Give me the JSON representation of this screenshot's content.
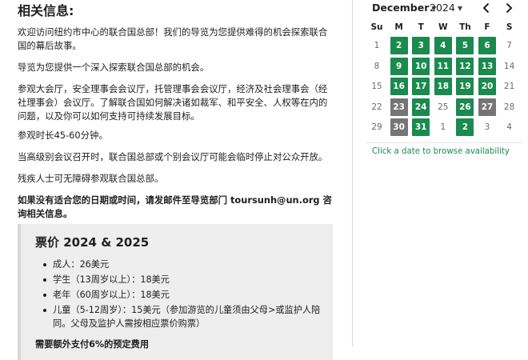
{
  "info": {
    "heading": "相关信息:",
    "paragraphs": [
      {
        "text": "欢迎访问纽约市中心的联合国总部！我们的导览为您提供难得的机会探索联合国的幕后故事。",
        "bold": false
      },
      {
        "text": "导览为您提供一个深入探索联合国总部的机会。",
        "bold": false
      },
      {
        "text": "参观大会厅，安全理事会会议厅，托管理事会会议厅，经济及社会理事会（经社理事会）会议厅。了解联合国如何解决诸如裁军、和平安全、人权等在内的问题，以及你可以如何支持可持续发展目标。",
        "bold": false
      },
      {
        "text": "参观时长45-60分钟。",
        "bold": false
      },
      {
        "text": "当高级别会议召开时，联合国总部或个别会议厅可能会临时停止对公众开放。",
        "bold": false
      },
      {
        "text": "残疾人士可无障碍参观联合国总部。",
        "bold": false
      },
      {
        "text": "如果没有适合您的日期或时间，请发邮件至导览部门 toursunh@un.org 咨询相关信息。",
        "bold": true
      }
    ]
  },
  "prices": {
    "heading": "票价 2024 & 2025",
    "items": [
      "成人：26美元",
      "学生（13周岁以上）：18美元",
      "老年（60周岁以上）：18美元",
      "儿童（5-12周岁）：15美元（参加游览的儿童须由父母>或监护人陪同。父母及监护人需按相应票价购票）"
    ],
    "note": "需要额外支付6%的预定费用"
  },
  "calendar": {
    "month": "December",
    "year": "2024",
    "prev_icon": "chevron-left-icon",
    "next_icon": "chevron-right-icon",
    "weekdays": [
      "Su",
      "M",
      "T",
      "W",
      "Th",
      "F",
      "S"
    ],
    "hint": "Click a date to browse availability",
    "colors": {
      "available": "#1a8a4f",
      "unavailable": "#757575",
      "hint": "#1a8a4f"
    },
    "weeks": [
      [
        {
          "d": "1",
          "s": "other"
        },
        {
          "d": "2",
          "s": "available"
        },
        {
          "d": "3",
          "s": "available"
        },
        {
          "d": "4",
          "s": "available"
        },
        {
          "d": "5",
          "s": "available"
        },
        {
          "d": "6",
          "s": "available"
        },
        {
          "d": "7",
          "s": "other"
        }
      ],
      [
        {
          "d": "8",
          "s": "other"
        },
        {
          "d": "9",
          "s": "available"
        },
        {
          "d": "10",
          "s": "available"
        },
        {
          "d": "11",
          "s": "available"
        },
        {
          "d": "12",
          "s": "available"
        },
        {
          "d": "13",
          "s": "available"
        },
        {
          "d": "14",
          "s": "other"
        }
      ],
      [
        {
          "d": "15",
          "s": "other"
        },
        {
          "d": "16",
          "s": "available"
        },
        {
          "d": "17",
          "s": "available"
        },
        {
          "d": "18",
          "s": "available"
        },
        {
          "d": "19",
          "s": "available"
        },
        {
          "d": "20",
          "s": "available"
        },
        {
          "d": "21",
          "s": "other"
        }
      ],
      [
        {
          "d": "22",
          "s": "other"
        },
        {
          "d": "23",
          "s": "unavailable"
        },
        {
          "d": "24",
          "s": "available"
        },
        {
          "d": "25",
          "s": "other"
        },
        {
          "d": "26",
          "s": "available"
        },
        {
          "d": "27",
          "s": "unavailable"
        },
        {
          "d": "28",
          "s": "other"
        }
      ],
      [
        {
          "d": "29",
          "s": "other"
        },
        {
          "d": "30",
          "s": "unavailable"
        },
        {
          "d": "31",
          "s": "available"
        },
        {
          "d": "1",
          "s": "other"
        },
        {
          "d": "2",
          "s": "available"
        },
        {
          "d": "3",
          "s": "other"
        },
        {
          "d": "4",
          "s": "other"
        }
      ]
    ]
  }
}
